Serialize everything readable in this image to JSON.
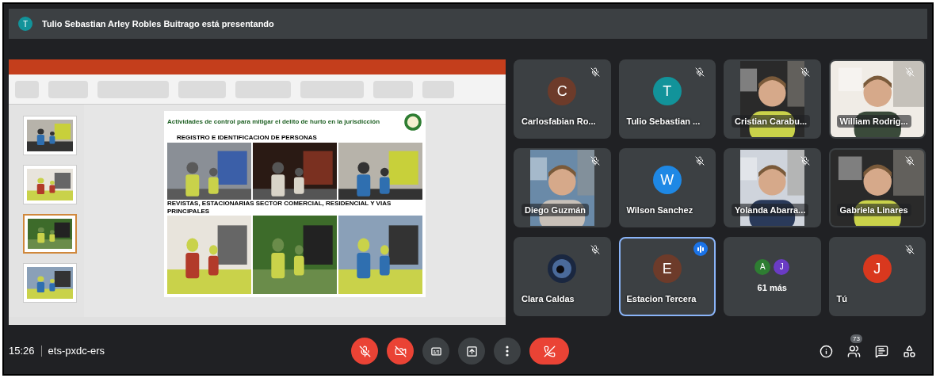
{
  "header": {
    "presenter_initial": "T",
    "title": "Tulio Sebastian Arley Robles Buitrago está presentando"
  },
  "slide": {
    "title": "Actividades de control para mitigar el delito de hurto en la jurisdicción",
    "section_1": "REGISTRO E IDENTIFICACION DE PERSONAS",
    "section_2": "REVISTAS, ESTACIONARIAS SECTOR COMERCIAL, RESIDENCIAL Y VIAS PRINCIPALES"
  },
  "thumbnails": [
    {
      "selected": false
    },
    {
      "selected": false
    },
    {
      "selected": true
    },
    {
      "selected": false
    }
  ],
  "tiles": [
    {
      "name": "Carlosfabian Ro...",
      "initial": "C",
      "color": "#6d3b2a",
      "muted": true,
      "speaking": false
    },
    {
      "name": "Tulio Sebastian ...",
      "initial": "T",
      "color": "#12939a",
      "muted": true,
      "speaking": false
    },
    {
      "kind": "video",
      "name": "Cristian Carabu...",
      "muted": true,
      "speaking": false
    },
    {
      "kind": "video",
      "name": "William Rodrig...",
      "muted": true,
      "speaking": false
    },
    {
      "kind": "video",
      "name": "Diego Guzmán",
      "muted": true,
      "speaking": false
    },
    {
      "name": "Wilson Sanchez",
      "initial": "W",
      "color": "#1e88e5",
      "muted": true,
      "speaking": false
    },
    {
      "kind": "video",
      "name": "Yolanda Abarra...",
      "muted": true,
      "speaking": false
    },
    {
      "kind": "video",
      "name": "Gabriela Linares",
      "muted": true,
      "speaking": false
    },
    {
      "kind": "photo-avatar",
      "name": "Clara Caldas",
      "muted": true,
      "speaking": false
    },
    {
      "name": "Estacion Tercera",
      "initial": "E",
      "color": "#6d3b2a",
      "muted": false,
      "speaking": true
    },
    {
      "kind": "more",
      "name": "61 más",
      "avatars": [
        {
          "initial": "A",
          "color": "#2e7d32"
        },
        {
          "initial": "J",
          "color": "#6a3bc4"
        }
      ]
    },
    {
      "name": "Tú",
      "initial": "J",
      "color": "#d9381e",
      "muted": true,
      "speaking": false
    }
  ],
  "footer": {
    "time": "15:26",
    "meeting_code": "ets-pxdc-ers",
    "mic_on": false,
    "camera_on": false,
    "people_count": "73"
  }
}
